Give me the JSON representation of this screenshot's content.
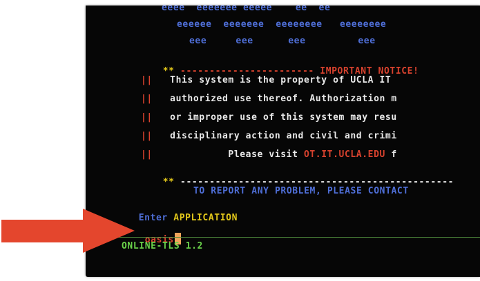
{
  "banner": {
    "row1": "eeee  eeeeeee eeeee    ee  ee",
    "row2": "eeeeee  eeeeeee  eeeeeeee   eeeeeeee",
    "row3": "eee     eee      eee         eee"
  },
  "notice": {
    "marker": "**",
    "dashes_left": "-----------------------",
    "heading": "IMPORTANT NOTICE!",
    "bar": "||",
    "line1": "This system is the property of UCLA IT",
    "line2": "authorized use thereof. Authorization m",
    "line3": "or improper use of this system may resu",
    "line4": "disciplinary action and civil and crimi",
    "line5_prefix": "Please visit ",
    "line5_link": "OT.IT.UCLA.EDU",
    "line5_suffix": " f",
    "bottom_dashes": "-----------------------------------------------"
  },
  "report_line": "TO REPORT ANY PROBLEM, PLEASE CONTACT",
  "prompt": {
    "enter": "Enter",
    "application": "APPLICATION",
    "input_value": "oasis"
  },
  "version": "ONLINE-TLS 1.2",
  "colors": {
    "background": "#060606",
    "blue": "#4f6fd8",
    "yellow": "#e3c81a",
    "red": "#d8422e",
    "green": "#6ad24a",
    "cursor": "#f0a55a",
    "arrow": "#e4462d"
  },
  "icons": {
    "pointer": "red-arrow-icon"
  }
}
